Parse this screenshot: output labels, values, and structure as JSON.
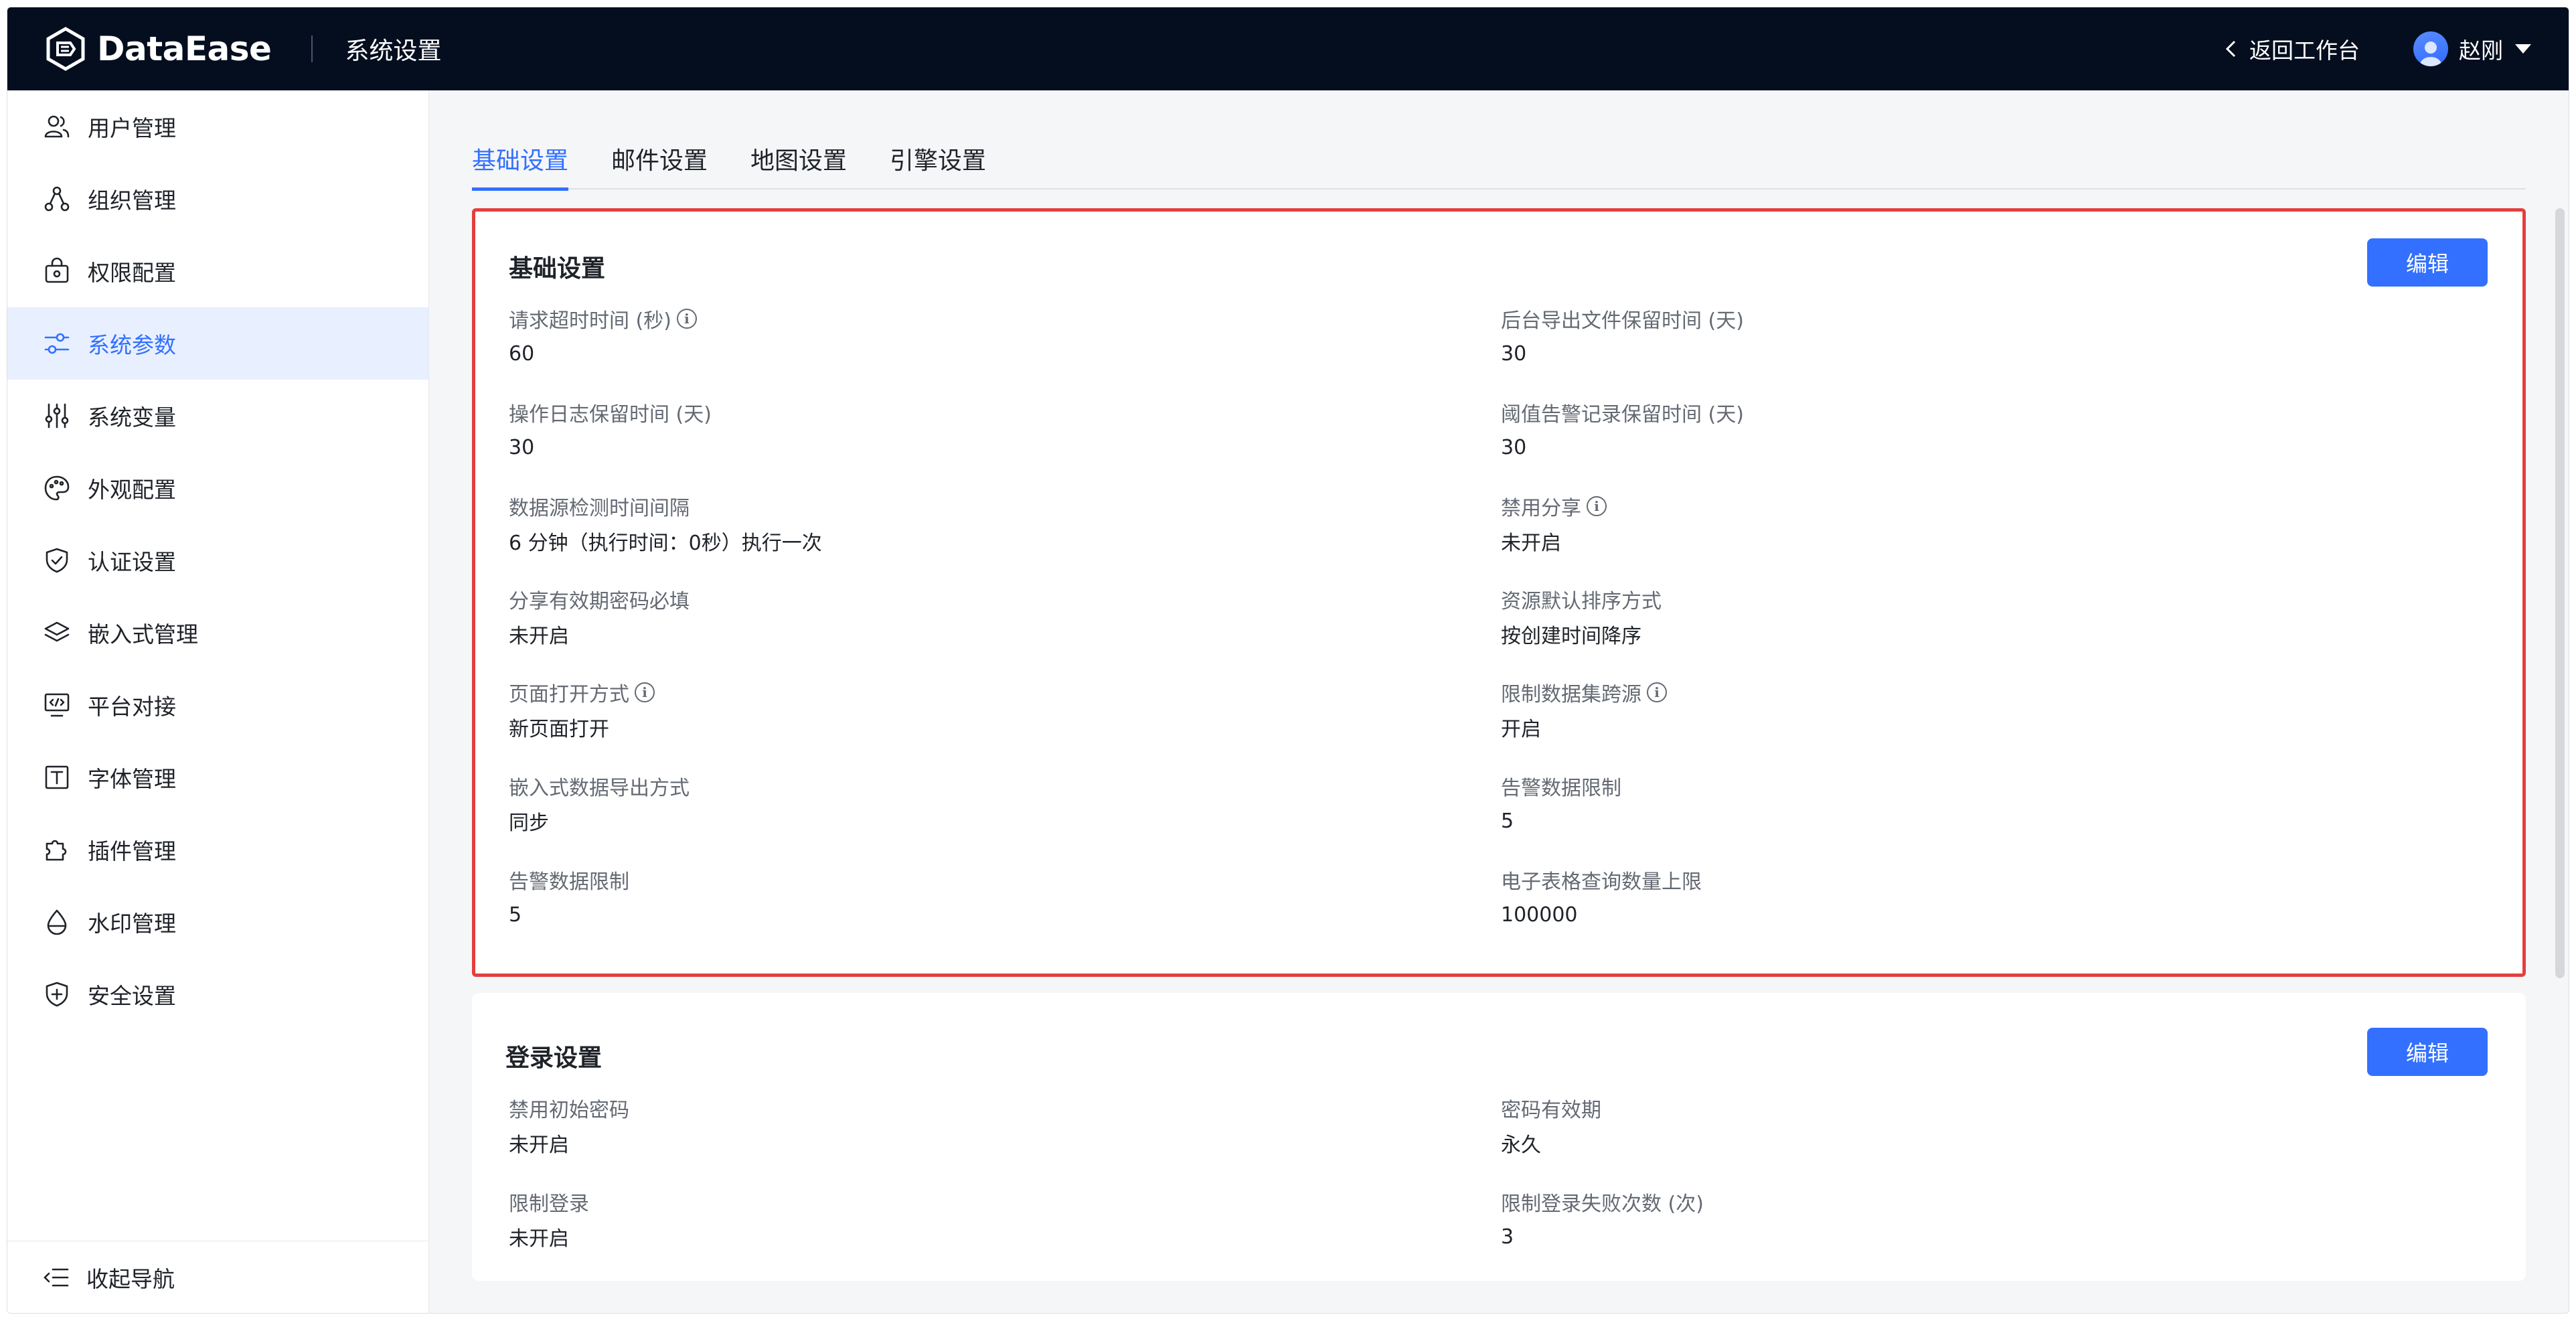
{
  "header": {
    "brand": "DataEase",
    "section_title": "系统设置",
    "back_label": "返回工作台",
    "user_name": "赵刚"
  },
  "sidebar": {
    "items": [
      {
        "label": "用户管理",
        "icon": "users-icon"
      },
      {
        "label": "组织管理",
        "icon": "org-icon"
      },
      {
        "label": "权限配置",
        "icon": "lock-box-icon"
      },
      {
        "label": "系统参数",
        "icon": "sliders-icon",
        "active": true
      },
      {
        "label": "系统变量",
        "icon": "variable-icon"
      },
      {
        "label": "外观配置",
        "icon": "palette-icon"
      },
      {
        "label": "认证设置",
        "icon": "shield-check-icon"
      },
      {
        "label": "嵌入式管理",
        "icon": "layers-icon"
      },
      {
        "label": "平台对接",
        "icon": "monitor-code-icon"
      },
      {
        "label": "字体管理",
        "icon": "font-icon"
      },
      {
        "label": "插件管理",
        "icon": "puzzle-icon"
      },
      {
        "label": "水印管理",
        "icon": "drop-icon"
      },
      {
        "label": "安全设置",
        "icon": "shield-plus-icon"
      }
    ],
    "collapse_label": "收起导航"
  },
  "tabs": [
    {
      "label": "基础设置",
      "active": true
    },
    {
      "label": "邮件设置"
    },
    {
      "label": "地图设置"
    },
    {
      "label": "引擎设置"
    }
  ],
  "basic": {
    "title": "基础设置",
    "edit_label": "编辑",
    "left": [
      {
        "label": "请求超时时间 (秒)",
        "value": "60",
        "info": true
      },
      {
        "label": "操作日志保留时间 (天)",
        "value": "30"
      },
      {
        "label": "数据源检测时间间隔",
        "value": "6 分钟（执行时间：0秒）执行一次"
      },
      {
        "label": "分享有效期密码必填",
        "value": "未开启"
      },
      {
        "label": "页面打开方式",
        "value": "新页面打开",
        "info": true
      },
      {
        "label": "嵌入式数据导出方式",
        "value": "同步"
      },
      {
        "label": "告警数据限制",
        "value": "5"
      }
    ],
    "right": [
      {
        "label": "后台导出文件保留时间 (天)",
        "value": "30"
      },
      {
        "label": "阈值告警记录保留时间 (天)",
        "value": "30"
      },
      {
        "label": "禁用分享",
        "value": "未开启",
        "info": true
      },
      {
        "label": "资源默认排序方式",
        "value": "按创建时间降序"
      },
      {
        "label": "限制数据集跨源",
        "value": "开启",
        "info": true
      },
      {
        "label": "告警数据限制",
        "value": "5"
      },
      {
        "label": "电子表格查询数量上限",
        "value": "100000"
      }
    ]
  },
  "login": {
    "title": "登录设置",
    "edit_label": "编辑",
    "left": [
      {
        "label": "禁用初始密码",
        "value": "未开启"
      },
      {
        "label": "限制登录",
        "value": "未开启"
      }
    ],
    "right": [
      {
        "label": "密码有效期",
        "value": "永久"
      },
      {
        "label": "限制登录失败次数 (次)",
        "value": "3"
      }
    ]
  },
  "colors": {
    "accent": "#3370ff",
    "header_bg": "#050e1f",
    "highlight_border": "#e53e3e"
  }
}
